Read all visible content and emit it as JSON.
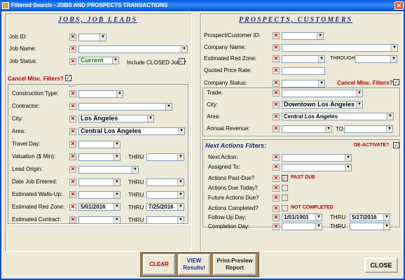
{
  "window": {
    "title": "Filtered Search - JOBS AND PROSPECTS TRANSACTIONS",
    "close": "✕"
  },
  "jobs": {
    "header": "JOBS, JOB LEADS",
    "job_id": "Job ID:",
    "job_name": "Job Name:",
    "job_status": "Job Status:",
    "job_status_value": "Current",
    "include_closed": "Include CLOSED Jobs?",
    "include_closed_check": "✓",
    "cancel_misc": "Cancel Misc. Filters?",
    "cancel_misc_check": "✓",
    "construction_type": "Construction Type:",
    "contractor": "Contractor:",
    "city": "City:",
    "city_value": "Los Angeles",
    "area": "Area:",
    "area_value": "Central Los Angeles",
    "travel_day": "Travel Day:",
    "valuation": "Valuation ($ Min):",
    "lead_origin": "Lead Origin:",
    "date_entered": "Date Job Entered:",
    "walls_up": "Estimated Walls-Up:",
    "red_zone": "Estimated Red Zone:",
    "red_zone_from": "5/01/2016",
    "red_zone_to": "7/25/2016",
    "est_contract": "Estimated Contract:",
    "thru": "THRU"
  },
  "prospects": {
    "header": "PROSPECTS, CUSTOMERS",
    "prospect_id": "Prospect/Customer ID:",
    "company_name": "Company Name:",
    "red_zone": "Estimated Red Zone:",
    "through": "THROUGH",
    "quoted_price": "Quoted Price Rate:",
    "company_status": "Company Status:",
    "cancel_misc": "Cancel Misc. Filters?",
    "cancel_misc_check": "✓",
    "trade": "Trade:",
    "city": "City:",
    "city_value": "Downtown Los Angeles",
    "area": "Area:",
    "area_value": "Central Los Angeles",
    "annual_revenue": "Annual Revenue:",
    "to": "TO"
  },
  "next_actions": {
    "header": "Next Actions Filters:",
    "deactivate": "DE-ACTIVATE?",
    "deactivate_check": "✓",
    "next_action": "Next Action:",
    "assigned_to": "Assigned To:",
    "past_due": "Actions Past-Due?",
    "past_due_check": "✓",
    "past_due_label": "PAST DUE",
    "due_today": "Actions Due Today?",
    "future_due": "Future Actions Due?",
    "completed": "Actions Completed?",
    "not_completed": "NOT COMPLETED",
    "follow_up": "Follow-Up Day:",
    "follow_up_from": "1/01/1901",
    "follow_up_to": "5/17/2016",
    "completion_day": "Completion Day:",
    "thru": "THRU"
  },
  "buttons": {
    "clear": "CLEAR",
    "view": "VIEW Results!",
    "print": "Print-Preview Report",
    "close": "CLOSE"
  },
  "icons": {
    "x_glyph": "✕",
    "dropdown_glyph": "▼"
  }
}
